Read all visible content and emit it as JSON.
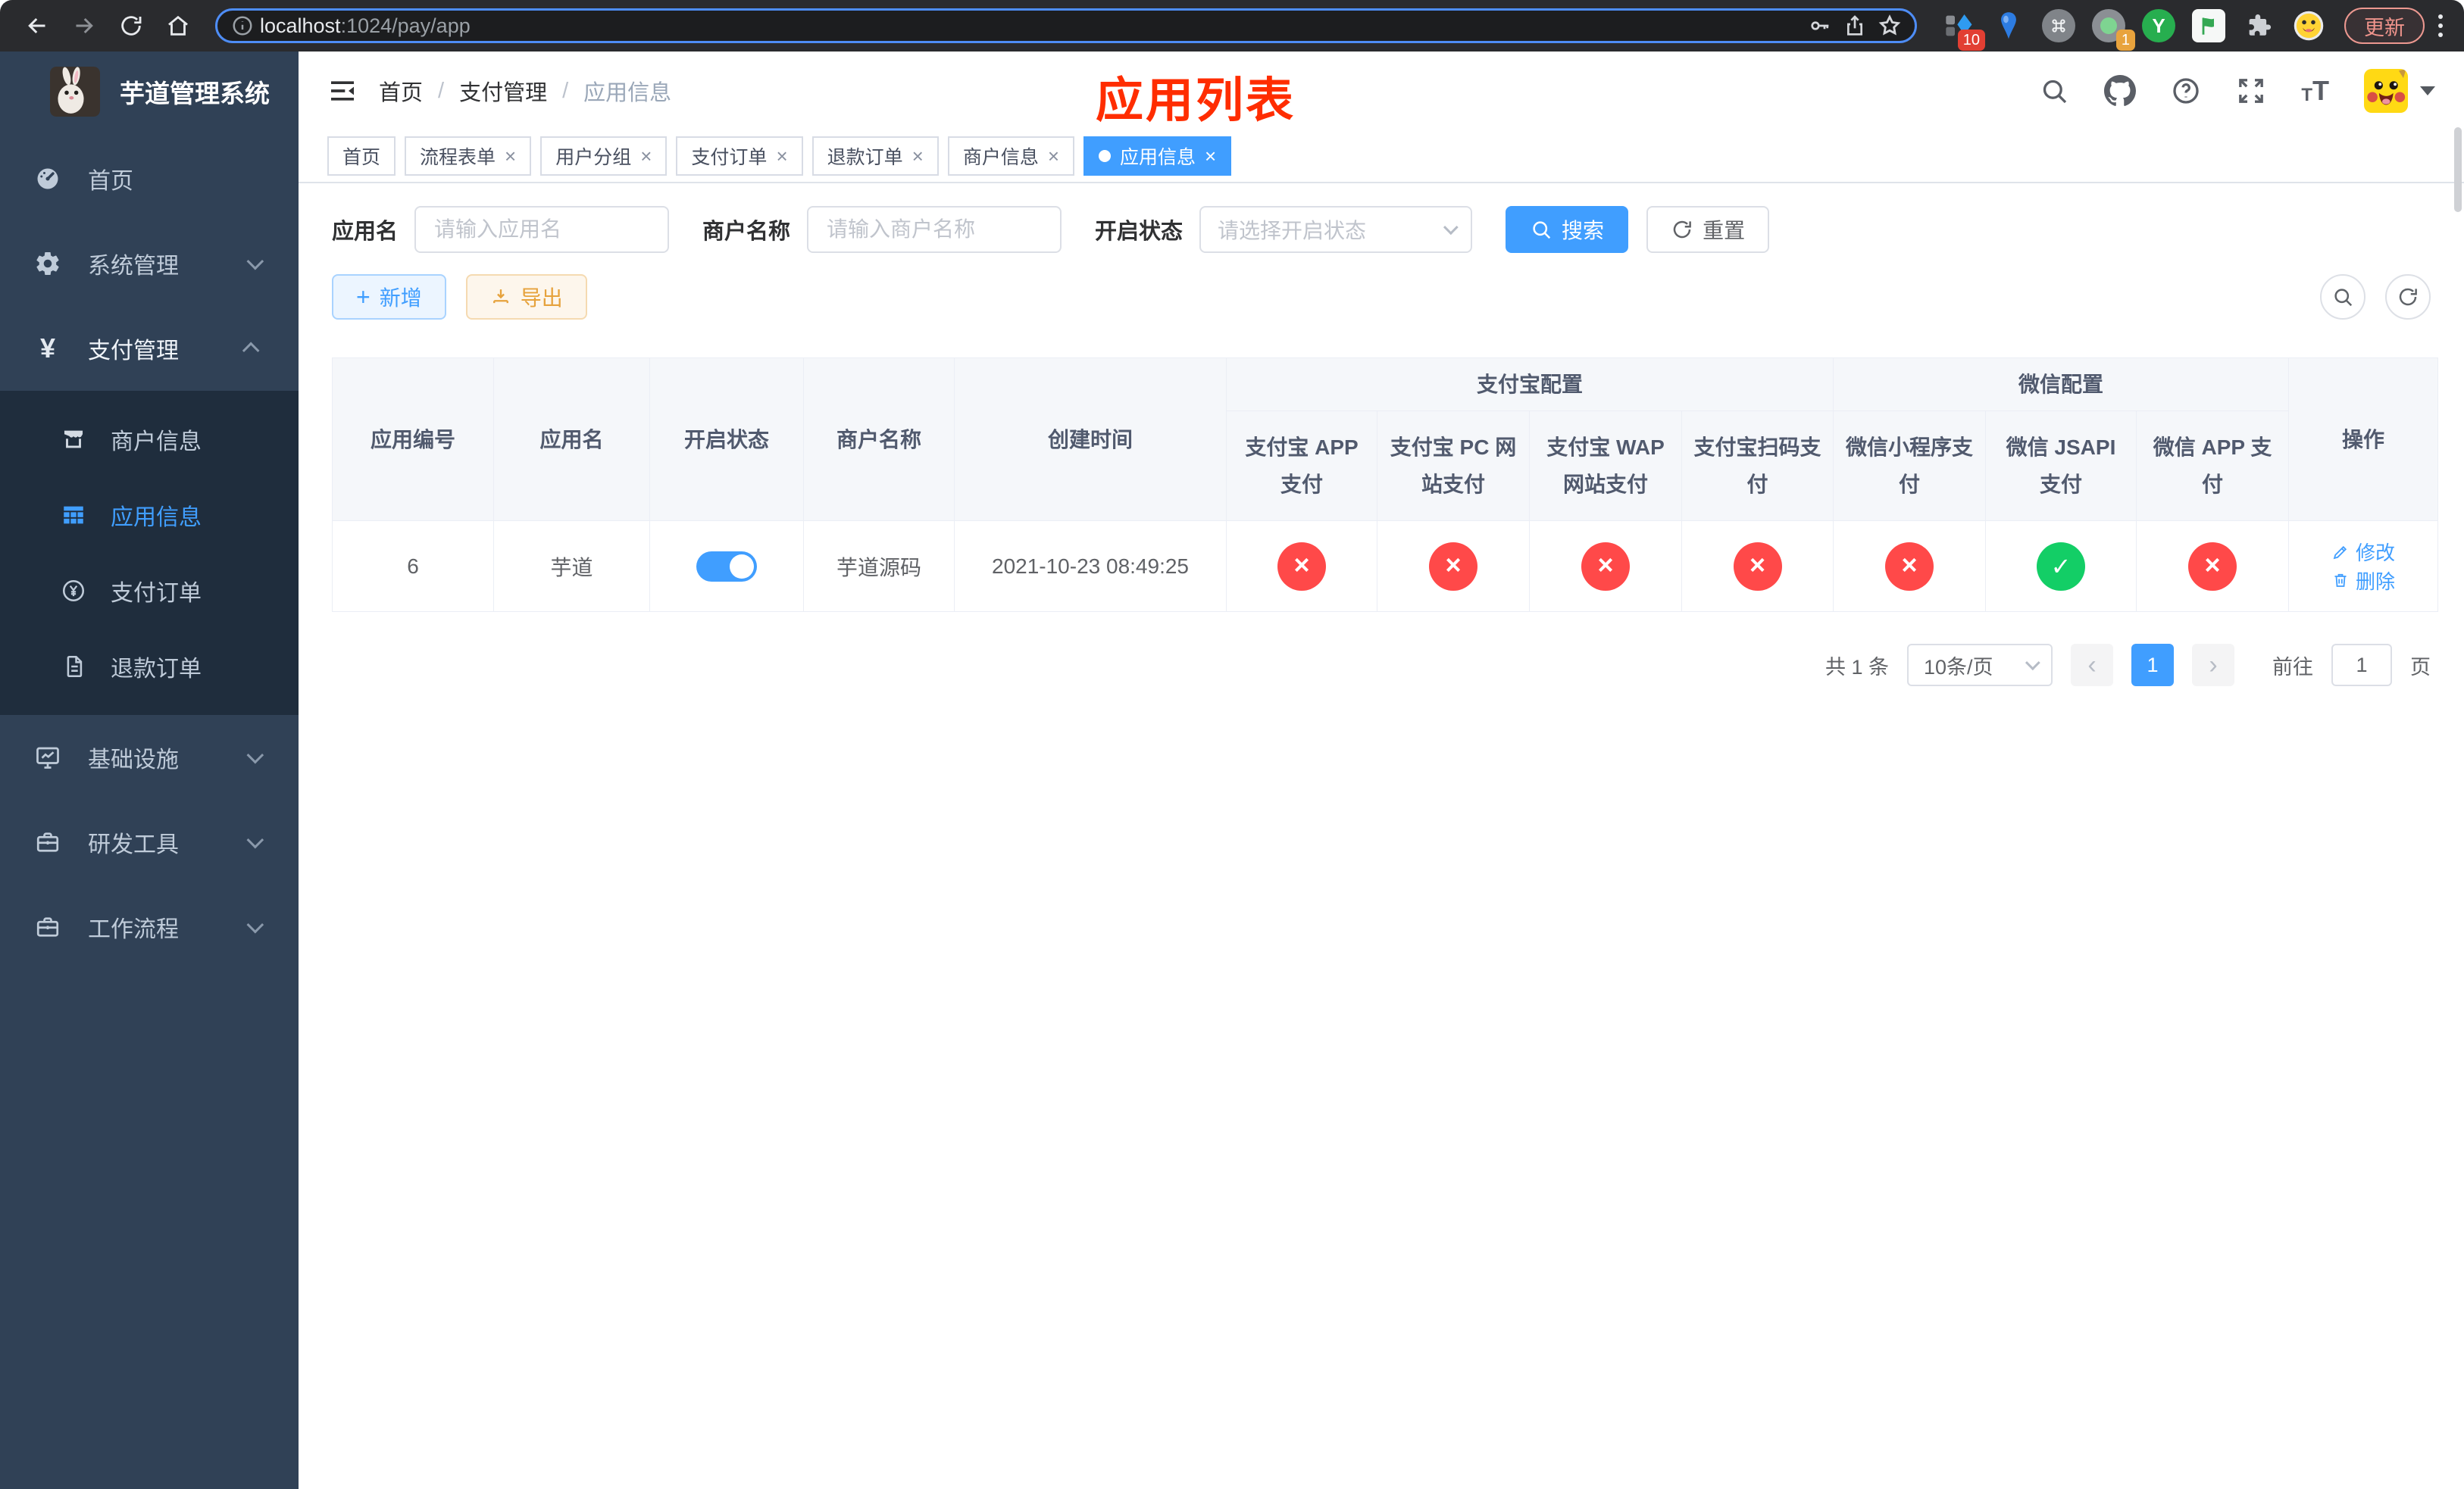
{
  "browser": {
    "url_host": "localhost",
    "url_path": ":1024/pay/app",
    "update_button": "更新",
    "ext_badge_pin": "10",
    "ext_badge_tab": "1",
    "ext_y_label": "Y"
  },
  "sidebar": {
    "title": "芋道管理系统",
    "items": [
      {
        "label": "首页"
      },
      {
        "label": "系统管理"
      },
      {
        "label": "支付管理"
      },
      {
        "label": "基础设施"
      },
      {
        "label": "研发工具"
      },
      {
        "label": "工作流程"
      }
    ],
    "payment_children": [
      {
        "label": "商户信息"
      },
      {
        "label": "应用信息"
      },
      {
        "label": "支付订单"
      },
      {
        "label": "退款订单"
      }
    ]
  },
  "header": {
    "breadcrumb": [
      "首页",
      "支付管理",
      "应用信息"
    ],
    "annotation": "应用列表"
  },
  "tabs": [
    {
      "label": "首页"
    },
    {
      "label": "流程表单"
    },
    {
      "label": "用户分组"
    },
    {
      "label": "支付订单"
    },
    {
      "label": "退款订单"
    },
    {
      "label": "商户信息"
    },
    {
      "label": "应用信息"
    }
  ],
  "filters": {
    "app_name_label": "应用名",
    "app_name_placeholder": "请输入应用名",
    "merchant_label": "商户名称",
    "merchant_placeholder": "请输入商户名称",
    "status_label": "开启状态",
    "status_placeholder": "请选择开启状态",
    "search": "搜索",
    "reset": "重置"
  },
  "toolbar": {
    "add": "新增",
    "export": "导出"
  },
  "table": {
    "columns": {
      "app_id": "应用编号",
      "app_name": "应用名",
      "status": "开启状态",
      "merchant": "商户名称",
      "created": "创建时间",
      "alipay_group": "支付宝配置",
      "wechat_group": "微信配置",
      "alipay_app": "支付宝 APP 支付",
      "alipay_pc": "支付宝 PC 网站支付",
      "alipay_wap": "支付宝 WAP 网站支付",
      "alipay_qr": "支付宝扫码支付",
      "wechat_lite": "微信小程序支付",
      "wechat_jsapi": "微信 JSAPI 支付",
      "wechat_app": "微信 APP 支付",
      "actions": "操作"
    },
    "rows": [
      {
        "app_id": "6",
        "app_name": "芋道",
        "enabled": true,
        "merchant": "芋道源码",
        "created": "2021-10-23 08:49:25",
        "alipay_app": false,
        "alipay_pc": false,
        "alipay_wap": false,
        "alipay_qr": false,
        "wechat_lite": false,
        "wechat_jsapi": true,
        "wechat_app": false
      }
    ],
    "actions": {
      "edit": "修改",
      "delete": "删除"
    }
  },
  "pagination": {
    "total": "共 1 条",
    "page_size": "10条/页",
    "prev": "‹",
    "page": "1",
    "next": "›",
    "goto": "前往",
    "goto_value": "1",
    "unit": "页"
  },
  "colors": {
    "accent": "#409eff",
    "danger": "#ff4949",
    "success": "#13ce66",
    "warning": "#e6a23c",
    "annotation": "#ff2d00",
    "sidebar_bg": "#304156",
    "submenu_bg": "#1f2d3d"
  }
}
